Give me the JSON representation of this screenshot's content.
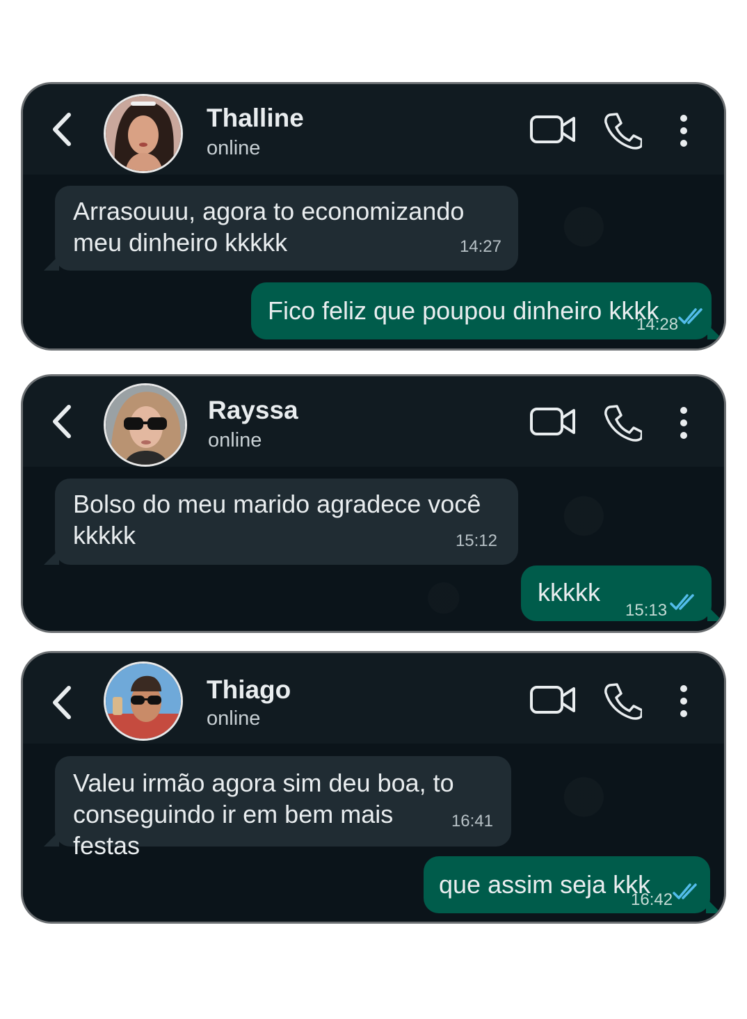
{
  "colors": {
    "header": "#111b21",
    "chat_background": "#0b141a",
    "incoming_bubble": "#202c33",
    "outgoing_bubble": "#005c4b",
    "read_ticks": "#53bdeb"
  },
  "icons": {
    "back": "chevron-left-icon",
    "video": "video-camera-icon",
    "call": "phone-icon",
    "menu": "more-vertical-icon",
    "read": "double-check-icon"
  },
  "chats": [
    {
      "contact": {
        "name": "Thalline",
        "status": "online"
      },
      "incoming": {
        "text": "Arrasouuu, agora to economizando meu dinheiro kkkkk",
        "time": "14:27"
      },
      "outgoing": {
        "text": "Fico feliz que poupou dinheiro kkkk",
        "time": "14:28"
      }
    },
    {
      "contact": {
        "name": "Rayssa",
        "status": "online"
      },
      "incoming": {
        "text": "Bolso do meu marido agradece você kkkkk",
        "time": "15:12"
      },
      "outgoing": {
        "text": "kkkkk",
        "time": "15:13"
      }
    },
    {
      "contact": {
        "name": "Thiago",
        "status": "online"
      },
      "incoming": {
        "text": "Valeu irmão agora sim deu boa, to conseguindo ir em bem mais festas",
        "time": "16:41"
      },
      "outgoing": {
        "text": "que assim seja kkk",
        "time": "16:42"
      }
    }
  ]
}
